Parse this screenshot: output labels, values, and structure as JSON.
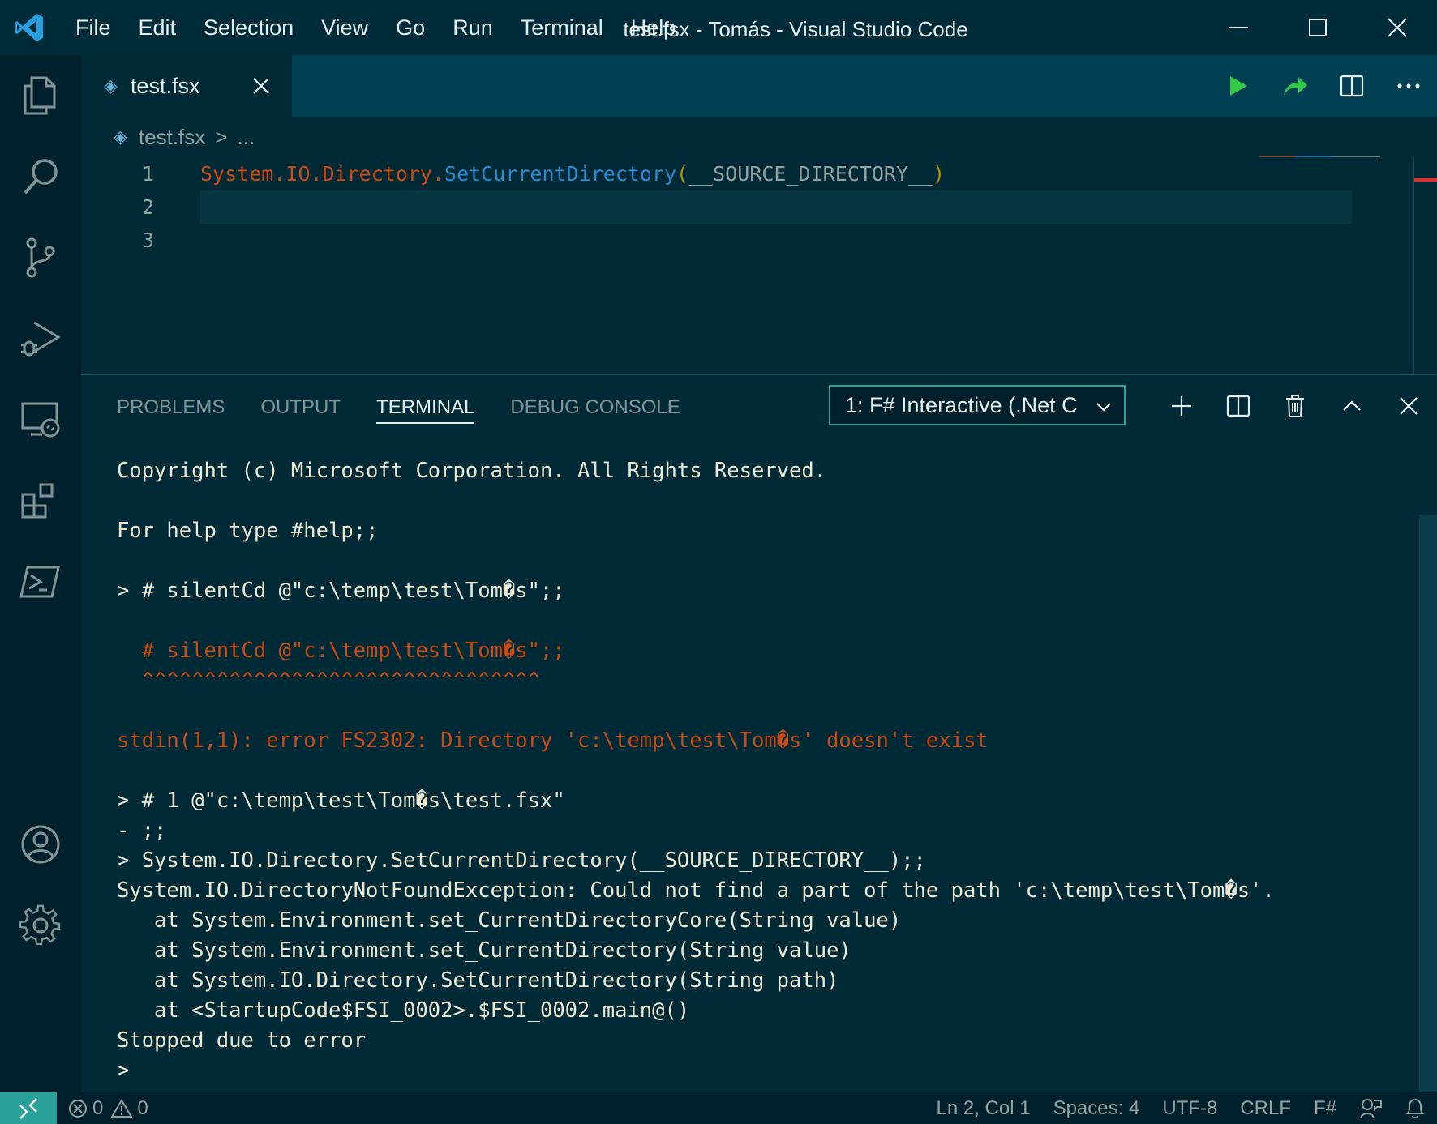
{
  "titlebar": {
    "menu": [
      "File",
      "Edit",
      "Selection",
      "View",
      "Go",
      "Run",
      "Terminal",
      "Help"
    ],
    "window_title": "test.fsx - Tomás - Visual Studio Code"
  },
  "activity_bar": {
    "icons": [
      "explorer-icon",
      "search-icon",
      "source-control-icon",
      "run-debug-icon",
      "remote-explorer-icon",
      "extensions-icon",
      "powershell-icon",
      "account-icon",
      "settings-gear-icon"
    ]
  },
  "editor": {
    "tab": {
      "label": "test.fsx"
    },
    "breadcrumb": {
      "file": "test.fsx",
      "separator": ">",
      "more": "..."
    },
    "lines": [
      {
        "number": "1",
        "segments": [
          {
            "text": "System.IO.Directory.",
            "color": "red"
          },
          {
            "text": "SetCurrentDirectory",
            "color": "blue"
          },
          {
            "text": "(",
            "color": "yellow"
          },
          {
            "text": "__SOURCE_DIRECTORY__",
            "color": "plain"
          },
          {
            "text": ")",
            "color": "yellow"
          }
        ]
      },
      {
        "number": "2",
        "segments": []
      },
      {
        "number": "3",
        "segments": []
      }
    ],
    "actions": [
      "run-icon",
      "send-to-fsi-icon",
      "split-editor-icon",
      "more-actions-icon"
    ]
  },
  "panel": {
    "tabs": [
      "PROBLEMS",
      "OUTPUT",
      "TERMINAL",
      "DEBUG CONSOLE"
    ],
    "active_tab": "TERMINAL",
    "terminal_select": "1: F# Interactive (.Net C",
    "terminal_lines": [
      {
        "text": "Copyright (c) Microsoft Corporation. All Rights Reserved.",
        "style": "normal"
      },
      {
        "text": "",
        "style": "gap"
      },
      {
        "text": "For help type #help;;",
        "style": "normal"
      },
      {
        "text": "",
        "style": "gap"
      },
      {
        "text": "> # silentCd @\"c:\\temp\\test\\Tom�s\";;",
        "style": "normal"
      },
      {
        "text": "",
        "style": "gap"
      },
      {
        "text": "  # silentCd @\"c:\\temp\\test\\Tom�s\";;",
        "style": "red"
      },
      {
        "text": "  ^^^^^^^^^^^^^^^^^^^^^^^^^^^^^^^^",
        "style": "red"
      },
      {
        "text": "",
        "style": "gap"
      },
      {
        "text": "stdin(1,1): error FS2302: Directory 'c:\\temp\\test\\Tom�s' doesn't exist",
        "style": "red"
      },
      {
        "text": "",
        "style": "gap"
      },
      {
        "text": "> # 1 @\"c:\\temp\\test\\Tom�s\\test.fsx\"",
        "style": "normal"
      },
      {
        "text": "- ;;",
        "style": "normal"
      },
      {
        "text": "> System.IO.Directory.SetCurrentDirectory(__SOURCE_DIRECTORY__);;",
        "style": "normal"
      },
      {
        "text": "System.IO.DirectoryNotFoundException: Could not find a part of the path 'c:\\temp\\test\\Tom�s'.",
        "style": "normal"
      },
      {
        "text": "   at System.Environment.set_CurrentDirectoryCore(String value)",
        "style": "normal"
      },
      {
        "text": "   at System.Environment.set_CurrentDirectory(String value)",
        "style": "normal"
      },
      {
        "text": "   at System.IO.Directory.SetCurrentDirectory(String path)",
        "style": "normal"
      },
      {
        "text": "   at <StartupCode$FSI_0002>.$FSI_0002.main@()",
        "style": "normal"
      },
      {
        "text": "Stopped due to error",
        "style": "normal"
      },
      {
        "text": ">",
        "style": "normal"
      }
    ],
    "actions": [
      "new-terminal-icon",
      "split-terminal-icon",
      "kill-terminal-icon",
      "maximize-panel-icon",
      "close-panel-icon"
    ]
  },
  "statusbar": {
    "errors": "0",
    "warnings": "0",
    "position": "Ln 2, Col 1",
    "spaces": "Spaces: 4",
    "encoding": "UTF-8",
    "eol": "CRLF",
    "language": "F#"
  },
  "colors": {
    "background": "#002b36",
    "keyword_red": "#cb4b16",
    "function_blue": "#268bd2",
    "paren_yellow": "#b58900",
    "accent_teal": "#2aa198",
    "run_green": "#2fc946"
  }
}
